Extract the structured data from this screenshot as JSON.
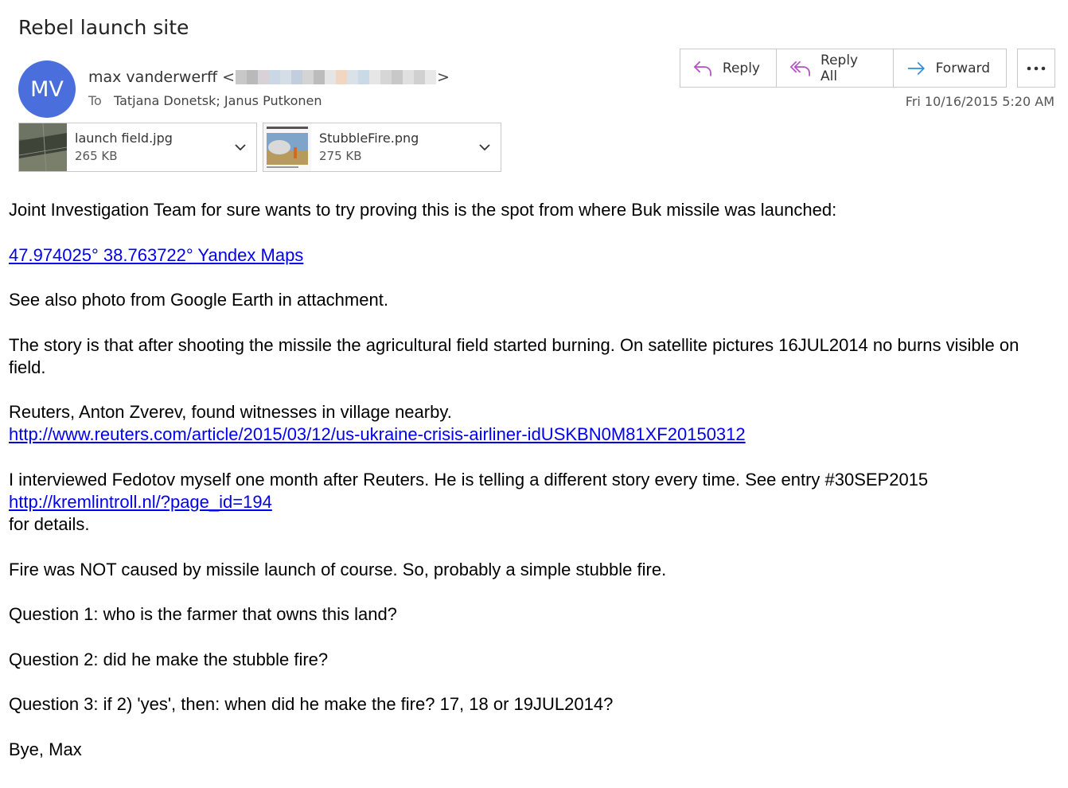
{
  "message": {
    "subject": "Rebel launch site",
    "avatar_initials": "MV",
    "sender_name": "max vanderwerff",
    "sender_email_open": "<",
    "sender_email_close": ">",
    "to_label": "To",
    "recipients": "Tatjana Donetsk; Janus Putkonen",
    "date": "Fri 10/16/2015 5:20 AM"
  },
  "actions": {
    "reply": "Reply",
    "reply_all": "Reply All",
    "forward": "Forward"
  },
  "attachments": [
    {
      "name": "launch field.jpg",
      "size": "265 KB"
    },
    {
      "name": "StubbleFire.png",
      "size": "275 KB"
    }
  ],
  "body": {
    "p1": "Joint Investigation Team for sure wants to try proving this is the spot from where Buk missile was launched:",
    "link_coords": " 47.974025°  38.763722° Yandex Maps",
    "p2": "See also photo from Google Earth in attachment.",
    "p3": "The story is that after shooting the missile the agricultural field started burning. On satellite pictures 16JUL2014 no burns visible on field.",
    "p4": "Reuters, Anton Zverev, found witnesses in village nearby.",
    "link_reuters": "http://www.reuters.com/article/2015/03/12/us-ukraine-crisis-airliner-idUSKBN0M81XF20150312",
    "p5": "I interviewed Fedotov myself one month after Reuters. He is telling a different story every time. See entry #30SEP2015",
    "link_kremlin": "http://kremlintroll.nl/?page_id=194",
    "p5_end": "for details.",
    "p6": "Fire was NOT caused by missile launch of course. So, probably a simple stubble fire.",
    "q1": "Question 1: who is the farmer that owns this land?",
    "q2": "Question 2: did he make the stubble fire?",
    "q3": "Question 3: if 2) 'yes', then: when did he make the fire? 17, 18 or 19JUL2014?",
    "signoff": "Bye, Max"
  },
  "colors": {
    "avatar": "#4a6fdc",
    "reply_icon": "#b44fc7",
    "forward_icon": "#2a8fd8",
    "link": "#0000ee"
  }
}
